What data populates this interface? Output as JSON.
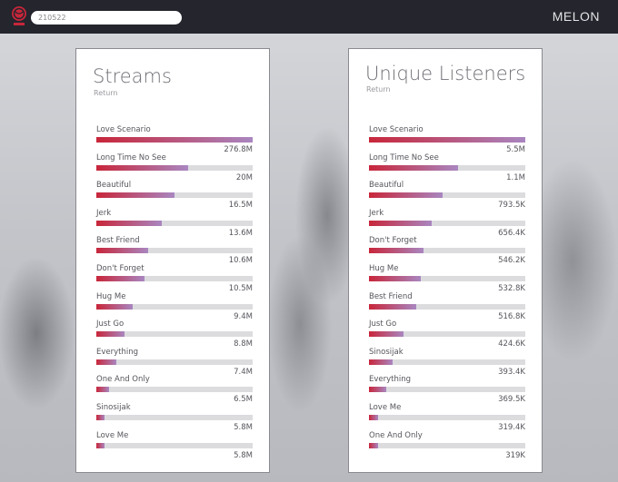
{
  "header": {
    "search_value": "210522",
    "brand": "MELON",
    "logo_icon": "globe-icon",
    "accent": "#c8263a"
  },
  "streams": {
    "title": "Streams",
    "subtitle": "Return",
    "items": [
      {
        "name": "Love Scenario",
        "value": "276.8M",
        "level": 1.0
      },
      {
        "name": "Long Time No See",
        "value": "20M",
        "level": 0.59
      },
      {
        "name": "Beautiful",
        "value": "16.5M",
        "level": 0.5
      },
      {
        "name": "Jerk",
        "value": "13.6M",
        "level": 0.42
      },
      {
        "name": "Best Friend",
        "value": "10.6M",
        "level": 0.33
      },
      {
        "name": "Don't Forget",
        "value": "10.5M",
        "level": 0.31
      },
      {
        "name": "Hug Me",
        "value": "9.4M",
        "level": 0.23
      },
      {
        "name": "Just Go",
        "value": "8.8M",
        "level": 0.18
      },
      {
        "name": "Everything",
        "value": "7.4M",
        "level": 0.13
      },
      {
        "name": "One And Only",
        "value": "6.5M",
        "level": 0.08
      },
      {
        "name": "Sinosijak",
        "value": "5.8M",
        "level": 0.05
      },
      {
        "name": "Love Me",
        "value": "5.8M",
        "level": 0.05
      }
    ]
  },
  "listeners": {
    "title": "Unique Listeners",
    "subtitle": "Return",
    "items": [
      {
        "name": "Love Scenario",
        "value": "5.5M",
        "level": 1.0
      },
      {
        "name": "Long Time No See",
        "value": "1.1M",
        "level": 0.57
      },
      {
        "name": "Beautiful",
        "value": "793.5K",
        "level": 0.47
      },
      {
        "name": "Jerk",
        "value": "656.4K",
        "level": 0.4
      },
      {
        "name": "Don't Forget",
        "value": "546.2K",
        "level": 0.35
      },
      {
        "name": "Hug Me",
        "value": "532.8K",
        "level": 0.33
      },
      {
        "name": "Best Friend",
        "value": "516.8K",
        "level": 0.3
      },
      {
        "name": "Just Go",
        "value": "424.6K",
        "level": 0.22
      },
      {
        "name": "Sinosijak",
        "value": "393.4K",
        "level": 0.15
      },
      {
        "name": "Everything",
        "value": "369.5K",
        "level": 0.11
      },
      {
        "name": "Love Me",
        "value": "319.4K",
        "level": 0.06
      },
      {
        "name": "One And Only",
        "value": "319K",
        "level": 0.06
      }
    ]
  }
}
